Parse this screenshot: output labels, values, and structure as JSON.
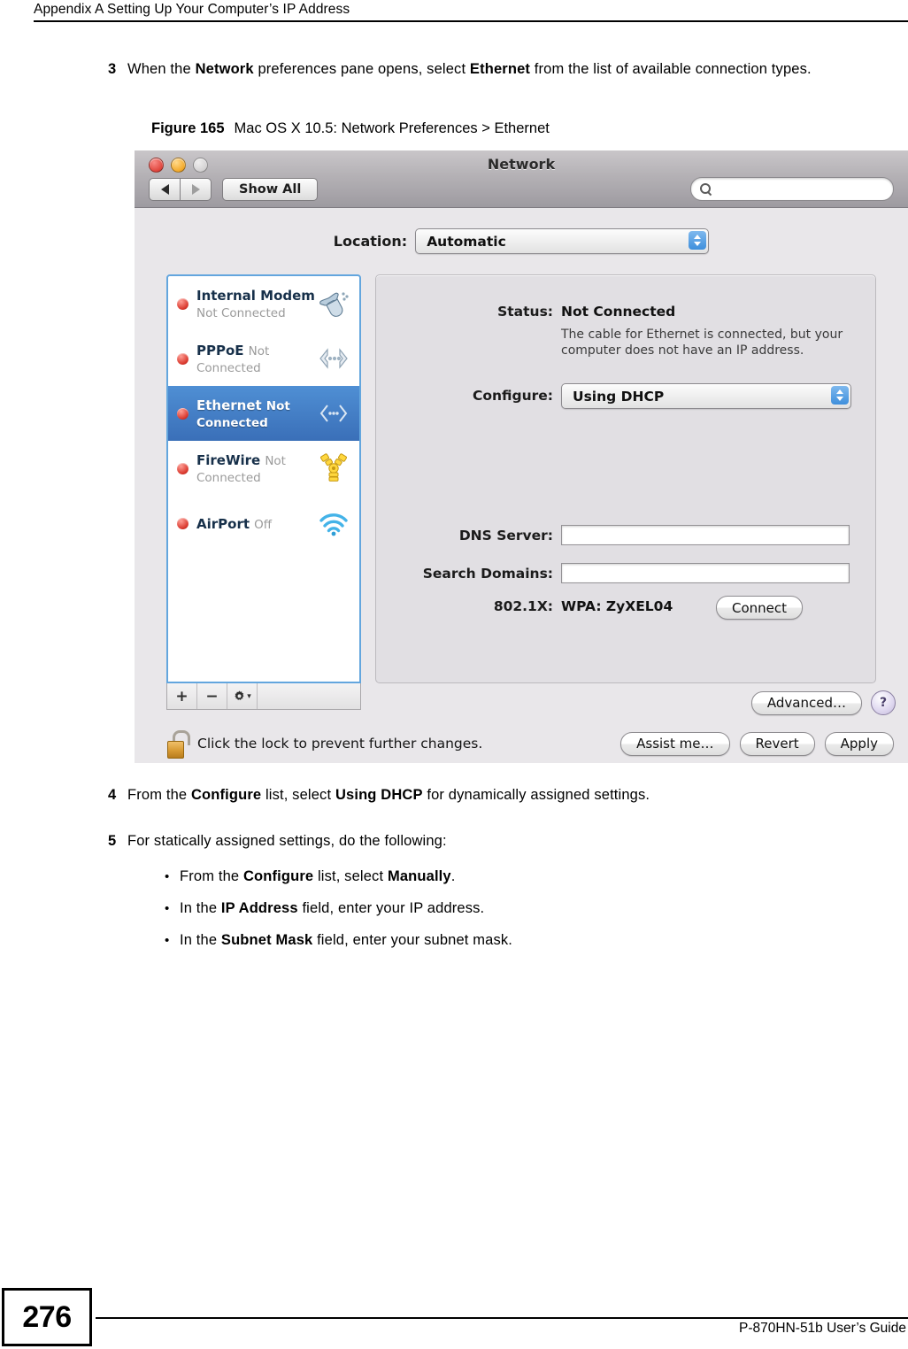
{
  "header": {
    "running_head": "Appendix A Setting Up Your Computer’s IP Address"
  },
  "steps": {
    "step3": {
      "num": "3",
      "text_parts": [
        "When the ",
        "Network",
        " preferences pane opens, select ",
        "Ethernet",
        " from the list of available connection types."
      ]
    },
    "step4": {
      "num": "4",
      "text_parts": [
        "From the ",
        "Configure",
        " list, select ",
        "Using DHCP",
        " for dynamically assigned settings."
      ]
    },
    "step5": {
      "num": "5",
      "text": "For statically assigned settings, do the following:"
    }
  },
  "bullets": [
    {
      "marker": "•",
      "parts": [
        "From the ",
        "Configure",
        " list, select ",
        "Manually",
        "."
      ]
    },
    {
      "marker": "•",
      "parts": [
        "In the ",
        "IP Address",
        " field, enter your IP address."
      ]
    },
    {
      "marker": "•",
      "parts": [
        "In the ",
        "Subnet Mask",
        " field, enter your subnet mask."
      ]
    }
  ],
  "figure": {
    "label": "Figure 165",
    "title": "Mac OS X 10.5: Network Preferences > Ethernet"
  },
  "mac_window": {
    "title": "Network",
    "toolbar": {
      "back_icon": "triangle-left-icon",
      "forward_icon": "triangle-right-icon",
      "show_all_label": "Show All",
      "search_placeholder": "",
      "search_value": "",
      "search_icon": "magnifier-icon"
    },
    "location": {
      "label": "Location:",
      "value": "Automatic"
    },
    "services": [
      {
        "name": "Internal Modem",
        "state": "Not Connected",
        "icon": "modem-phone-icon",
        "selected": false
      },
      {
        "name": "PPPoE",
        "state": "Not Connected",
        "icon": "pppoe-arrows-icon",
        "selected": false
      },
      {
        "name": "Ethernet",
        "state": "Not Connected",
        "icon": "ethernet-arrows-icon",
        "selected": true
      },
      {
        "name": "FireWire",
        "state": "Not Connected",
        "icon": "firewire-icon",
        "selected": false
      },
      {
        "name": "AirPort",
        "state": "Off",
        "icon": "wifi-icon",
        "selected": false
      }
    ],
    "list_toolbar": {
      "add_label": "+",
      "remove_label": "−",
      "gear_icon": "gear-icon"
    },
    "detail": {
      "status_label": "Status:",
      "status_value": "Not Connected",
      "status_description": "The cable for Ethernet is connected, but your computer does not have an IP address.",
      "configure_label": "Configure:",
      "configure_value": "Using DHCP",
      "dns_label": "DNS Server:",
      "dns_value": "",
      "search_domains_label": "Search Domains:",
      "search_domains_value": "",
      "dot1x_label": "802.1X:",
      "dot1x_value": "WPA: ZyXEL04",
      "connect_label": "Connect",
      "advanced_label": "Advanced…",
      "help_label": "?"
    },
    "bottom": {
      "lock_icon": "unlocked-padlock-icon",
      "lock_text": "Click the lock to prevent further changes.",
      "assist_label": "Assist me…",
      "revert_label": "Revert",
      "apply_label": "Apply"
    }
  },
  "footer": {
    "page_number": "276",
    "guide": "P-870HN-51b User’s Guide"
  },
  "colors": {
    "selection_blue": "#3a6fb8",
    "status_red": "#d9372c",
    "stepper_blue": "#3e8fdc"
  }
}
